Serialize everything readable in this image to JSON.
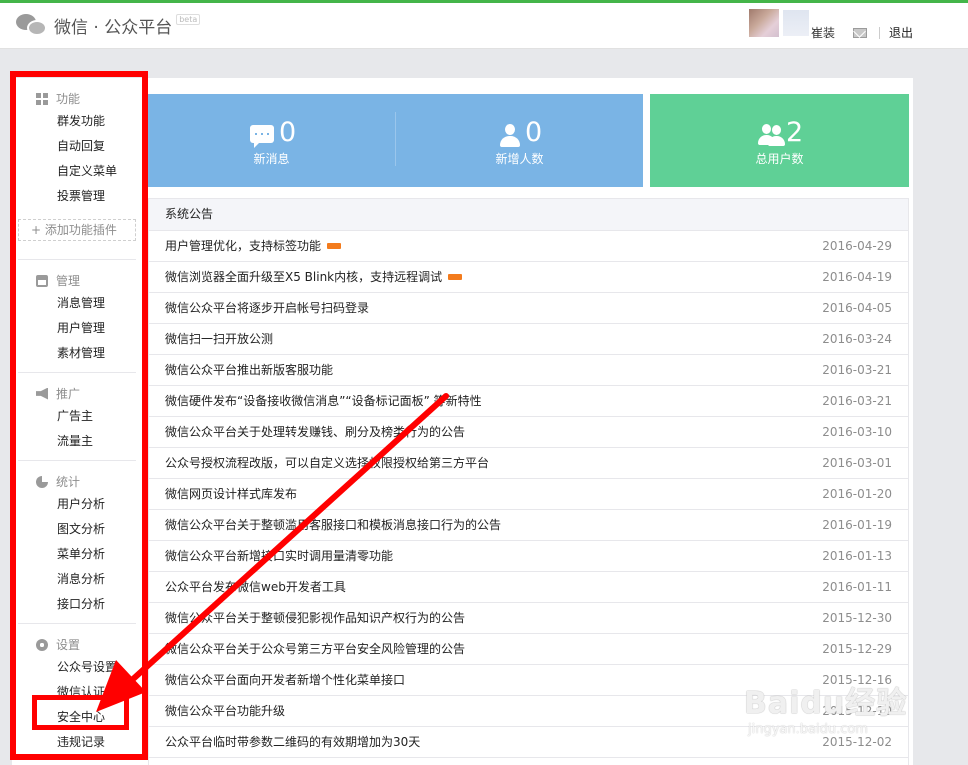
{
  "header": {
    "title": "微信 · 公众平台",
    "beta": "beta",
    "user_name": "崔装",
    "logout": "退出"
  },
  "sidebar": {
    "groups": [
      {
        "label": "功能",
        "icon": "grid-icon",
        "items": [
          "群发功能",
          "自动回复",
          "自定义菜单",
          "投票管理"
        ]
      },
      {
        "label": "管理",
        "icon": "inbox-icon",
        "items": [
          "消息管理",
          "用户管理",
          "素材管理"
        ]
      },
      {
        "label": "推广",
        "icon": "megaphone-icon",
        "items": [
          "广告主",
          "流量主"
        ]
      },
      {
        "label": "统计",
        "icon": "pie-chart-icon",
        "items": [
          "用户分析",
          "图文分析",
          "菜单分析",
          "消息分析",
          "接口分析"
        ]
      },
      {
        "label": "设置",
        "icon": "gear-icon",
        "items": [
          "公众号设置",
          "微信认证",
          "安全中心",
          "违规记录"
        ]
      }
    ],
    "add_plugin": "+ 添加功能插件"
  },
  "stats": [
    {
      "value": "0",
      "label": "新消息",
      "icon": "message-icon"
    },
    {
      "value": "0",
      "label": "新增人数",
      "icon": "user-icon"
    },
    {
      "value": "2",
      "label": "总用户数",
      "icon": "users-icon"
    }
  ],
  "announcements": {
    "title": "系统公告",
    "rows": [
      {
        "title": "用户管理优化，支持标签功能",
        "date": "2016-04-29",
        "is_new": true
      },
      {
        "title": "微信浏览器全面升级至X5 Blink内核，支持远程调试",
        "date": "2016-04-19",
        "is_new": true
      },
      {
        "title": "微信公众平台将逐步开启帐号扫码登录",
        "date": "2016-04-05",
        "is_new": false
      },
      {
        "title": "微信扫一扫开放公测",
        "date": "2016-03-24",
        "is_new": false
      },
      {
        "title": "微信公众平台推出新版客服功能",
        "date": "2016-03-21",
        "is_new": false
      },
      {
        "title": "微信硬件发布“设备接收微信消息”“设备标记面板” 等新特性",
        "date": "2016-03-21",
        "is_new": false
      },
      {
        "title": "微信公众平台关于处理转发赚钱、刷分及榜类行为的公告",
        "date": "2016-03-10",
        "is_new": false
      },
      {
        "title": "公众号授权流程改版，可以自定义选择权限授权给第三方平台",
        "date": "2016-03-01",
        "is_new": false
      },
      {
        "title": "微信网页设计样式库发布",
        "date": "2016-01-20",
        "is_new": false
      },
      {
        "title": "微信公众平台关于整顿滥用客服接口和模板消息接口行为的公告",
        "date": "2016-01-19",
        "is_new": false
      },
      {
        "title": "微信公众平台新增接口实时调用量清零功能",
        "date": "2016-01-13",
        "is_new": false
      },
      {
        "title": "公众平台发布微信web开发者工具",
        "date": "2016-01-11",
        "is_new": false
      },
      {
        "title": "微信公众平台关于整顿侵犯影视作品知识产权行为的公告",
        "date": "2015-12-30",
        "is_new": false
      },
      {
        "title": "微信公众平台关于公众号第三方平台安全风险管理的公告",
        "date": "2015-12-29",
        "is_new": false
      },
      {
        "title": "微信公众平台面向开发者新增个性化菜单接口",
        "date": "2015-12-16",
        "is_new": false
      },
      {
        "title": "微信公众平台功能升级",
        "date": "2015-12-10",
        "is_new": false
      },
      {
        "title": "公众平台临时带参数二维码的有效期增加为30天",
        "date": "2015-12-02",
        "is_new": false
      }
    ]
  },
  "watermark": {
    "logo": "Baidu经验",
    "sub": "jingyan.baidu.com"
  },
  "colors": {
    "stat_blue": "#7ab4e5",
    "stat_green": "#5fd096",
    "annotation": "#ff0000",
    "top_line": "#44b549"
  }
}
